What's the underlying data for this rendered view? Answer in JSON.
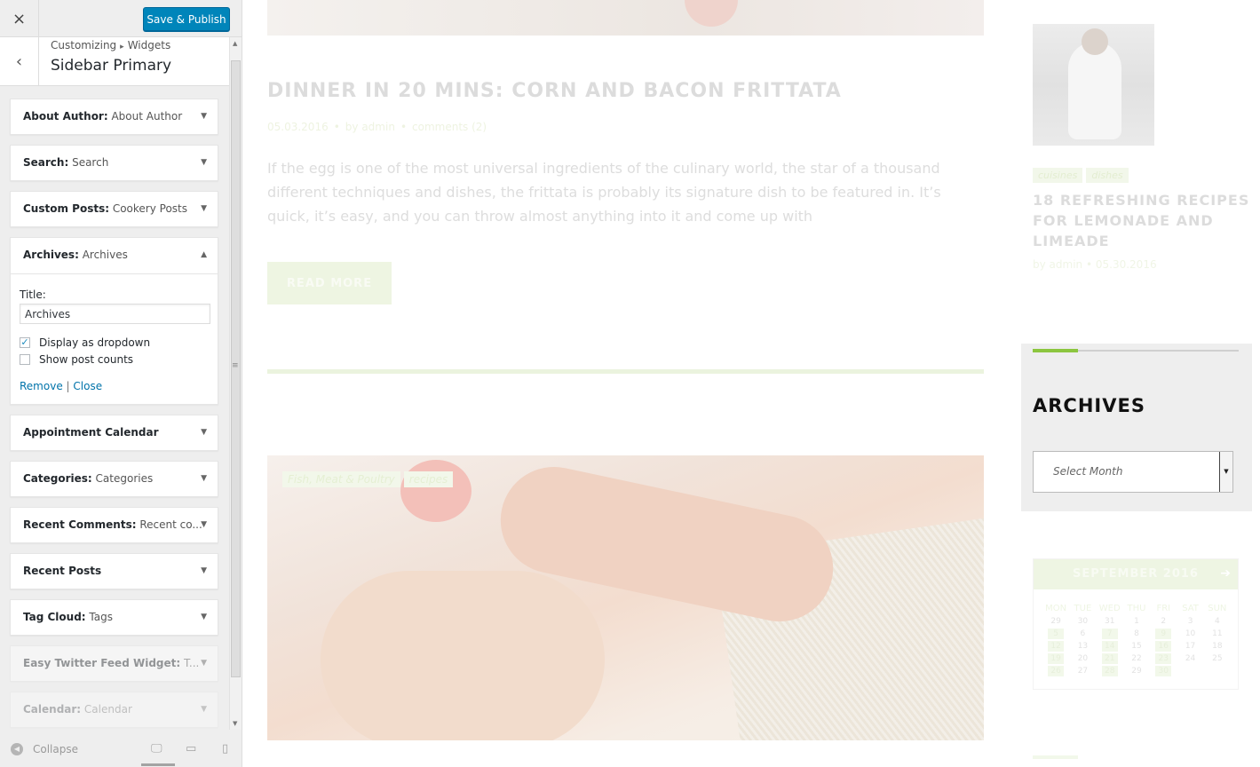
{
  "customizer": {
    "close_icon": "×",
    "save_button": "Save & Publish",
    "breadcrumb": {
      "root": "Customizing",
      "separator": "▸",
      "current": "Widgets"
    },
    "section_title": "Sidebar Primary",
    "back_icon": "‹"
  },
  "widgets": [
    {
      "type": "About Author:",
      "title": " About Author"
    },
    {
      "type": "Search:",
      "title": " Search"
    },
    {
      "type": "Custom Posts:",
      "title": " Cookery Posts"
    },
    {
      "type": "Archives:",
      "title": " Archives"
    },
    {
      "type": "Appointment Calendar",
      "title": ""
    },
    {
      "type": "Categories:",
      "title": " Categories"
    },
    {
      "type": "Recent Comments:",
      "title": " Recent co..."
    },
    {
      "type": "Recent Posts",
      "title": ""
    },
    {
      "type": "Tag Cloud:",
      "title": " Tags"
    },
    {
      "type": "Easy Twitter Feed Widget:",
      "title": " T..."
    },
    {
      "type": "Calendar:",
      "title": " Calendar"
    }
  ],
  "archives_form": {
    "title_label": "Title:",
    "title_value": "Archives",
    "dropdown_label": "Display as dropdown",
    "dropdown_checked": true,
    "counts_label": "Show post counts",
    "counts_checked": false,
    "remove_link": "Remove",
    "link_separator": "|",
    "close_link": "Close"
  },
  "footer": {
    "collapse_label": "Collapse"
  },
  "preview": {
    "post": {
      "title": "DINNER IN 20 MINS: CORN AND BACON FRITTATA",
      "date": "05.03.2016",
      "author": "by admin",
      "comments": "comments (2)",
      "excerpt": "If the egg is one of the most universal ingredients of the culinary world, the star of a thousand different techniques and dishes, the frittata is probably its signature dish to be featured in. It’s quick, it’s easy, and you can throw almost anything into it and come up with",
      "read_more": "READ MORE"
    },
    "post2_tags": [
      "Fish, Meat & Poultry",
      "recipes"
    ],
    "sidebar_post": {
      "tags": [
        "cuisines",
        "dishes"
      ],
      "title": "18 REFRESHING RECIPES FOR LEMONADE AND LIMEADE",
      "author": "by admin",
      "date": "05.30.2016"
    },
    "archives_widget": {
      "title": "ARCHIVES",
      "select_placeholder": "Select Month"
    },
    "calendar": {
      "month": "SEPTEMBER 2016",
      "next_icon": "➔",
      "days_of_week": [
        "MON",
        "TUE",
        "WED",
        "THU",
        "FRI",
        "SAT",
        "SUN"
      ],
      "weeks": [
        [
          "29",
          "30",
          "31",
          "1",
          "2",
          "3",
          "4"
        ],
        [
          "5",
          "6",
          "7",
          "8",
          "9",
          "10",
          "11"
        ],
        [
          "12",
          "13",
          "14",
          "15",
          "16",
          "17",
          "18"
        ],
        [
          "19",
          "20",
          "21",
          "22",
          "23",
          "24",
          "25"
        ],
        [
          "26",
          "27",
          "28",
          "29",
          "30",
          "",
          ""
        ]
      ],
      "highlighted_days": [
        "5",
        "7",
        "9",
        "12",
        "14",
        "16",
        "19",
        "21",
        "23",
        "26",
        "28",
        "30"
      ]
    },
    "accent_color": "#8cc63f"
  }
}
